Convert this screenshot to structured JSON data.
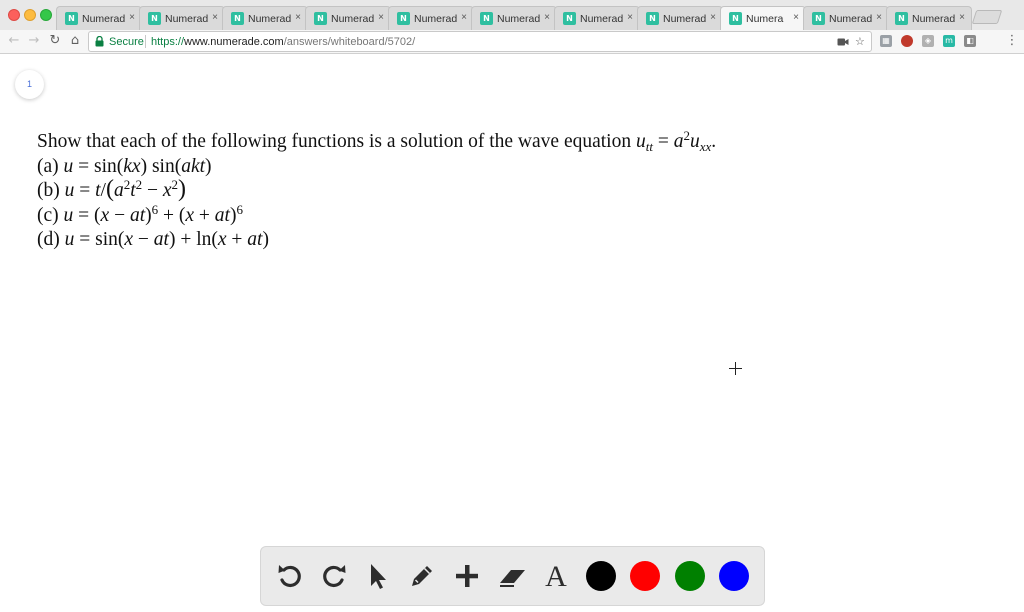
{
  "browser": {
    "tabs": [
      {
        "title": "Numerade",
        "favicon": "N",
        "close": "×"
      },
      {
        "title": "Numerade",
        "favicon": "N",
        "close": "×"
      },
      {
        "title": "Numerade",
        "favicon": "N",
        "close": "×"
      },
      {
        "title": "Numerade",
        "favicon": "N",
        "close": "×"
      },
      {
        "title": "Numerade",
        "favicon": "N",
        "close": "×"
      },
      {
        "title": "Numerade",
        "favicon": "N",
        "close": "×"
      },
      {
        "title": "Numerade",
        "favicon": "N",
        "close": "×"
      },
      {
        "title": "Numerade",
        "favicon": "N",
        "close": "×"
      },
      {
        "title": "Numera",
        "favicon": "N",
        "close": "×",
        "active": true
      },
      {
        "title": "Numerade",
        "favicon": "N",
        "close": "×"
      },
      {
        "title": "Numerade",
        "favicon": "N",
        "close": "×"
      }
    ],
    "toolbar": {
      "back_icon": "←",
      "forward_icon": "→",
      "reload_icon": "↻",
      "home_icon": "⌂",
      "secure_label": "Secure",
      "url_scheme": "https://",
      "url_host": "www.numerade.com",
      "url_path": "/answers/whiteboard/5702/",
      "star_icon": "☆"
    },
    "extensions": [
      {
        "name": "extension-icon-1",
        "glyph": "▦",
        "color": "#9aa0a6"
      },
      {
        "name": "flag-extension-icon",
        "glyph": "",
        "color": "#c0392b"
      },
      {
        "name": "extension-icon-2",
        "glyph": "◈",
        "color": "#b0b0b0"
      },
      {
        "name": "extension-icon-m",
        "glyph": "m",
        "color": "#28b9a5"
      },
      {
        "name": "extension-icon-3",
        "glyph": "◧",
        "color": "#8a8a8a"
      }
    ],
    "menu_icon": "⋮"
  },
  "whiteboard": {
    "page_number": "1",
    "question": {
      "intro": "Show that each of the following functions is a solution of the wave equation ",
      "equation_lhs": "u",
      "equation_lhs_sub": "tt",
      "equals": " = ",
      "equation_rhs_base": "a",
      "equation_rhs_exp": "2",
      "equation_rhs_var": "u",
      "equation_rhs_sub": "xx",
      "end": ".",
      "parts": {
        "a": {
          "label": "(a) "
        },
        "b": {
          "label": "(b) "
        },
        "c": {
          "label": "(c) "
        },
        "d": {
          "label": "(d) "
        }
      }
    },
    "colors": {
      "black": "#000000",
      "red": "#ff0000",
      "green": "#008000",
      "blue": "#0000ff"
    }
  },
  "drawing_tools": {
    "text_tool_label": "A",
    "tools": [
      "undo-icon",
      "redo-icon",
      "pointer-icon",
      "pencil-icon",
      "plus-icon",
      "eraser-icon",
      "text-tool-icon"
    ],
    "swatches": [
      "black",
      "red",
      "green",
      "blue"
    ]
  }
}
